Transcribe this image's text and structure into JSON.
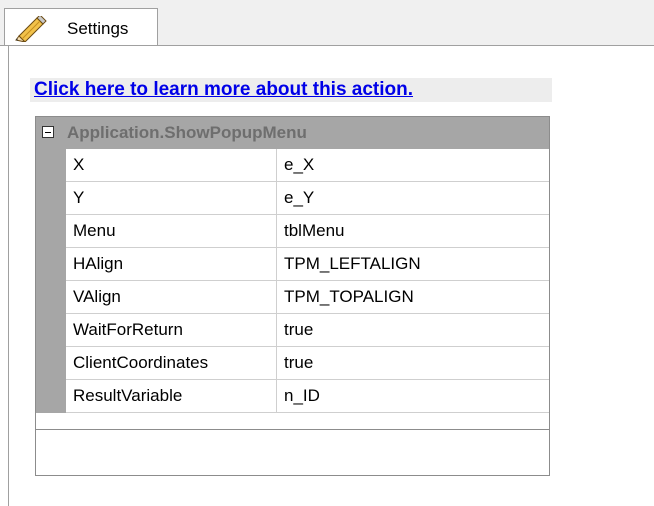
{
  "tab": {
    "label": "Settings",
    "icon": "pencil-icon"
  },
  "help_link": {
    "text": "Click here to learn more about this action."
  },
  "property_grid": {
    "section_title": "Application.ShowPopupMenu",
    "collapse_icon": "minus-box-icon",
    "rows": [
      {
        "name": "X",
        "value": "e_X"
      },
      {
        "name": "Y",
        "value": "e_Y"
      },
      {
        "name": "Menu",
        "value": "tblMenu"
      },
      {
        "name": "HAlign",
        "value": "TPM_LEFTALIGN"
      },
      {
        "name": "VAlign",
        "value": "TPM_TOPALIGN"
      },
      {
        "name": "WaitForReturn",
        "value": "true"
      },
      {
        "name": "ClientCoordinates",
        "value": "true"
      },
      {
        "name": "ResultVariable",
        "value": "n_ID"
      }
    ]
  },
  "colors": {
    "link": "#0000e8",
    "header_background": "#a6a6a6",
    "header_text": "#6e6e6e"
  }
}
